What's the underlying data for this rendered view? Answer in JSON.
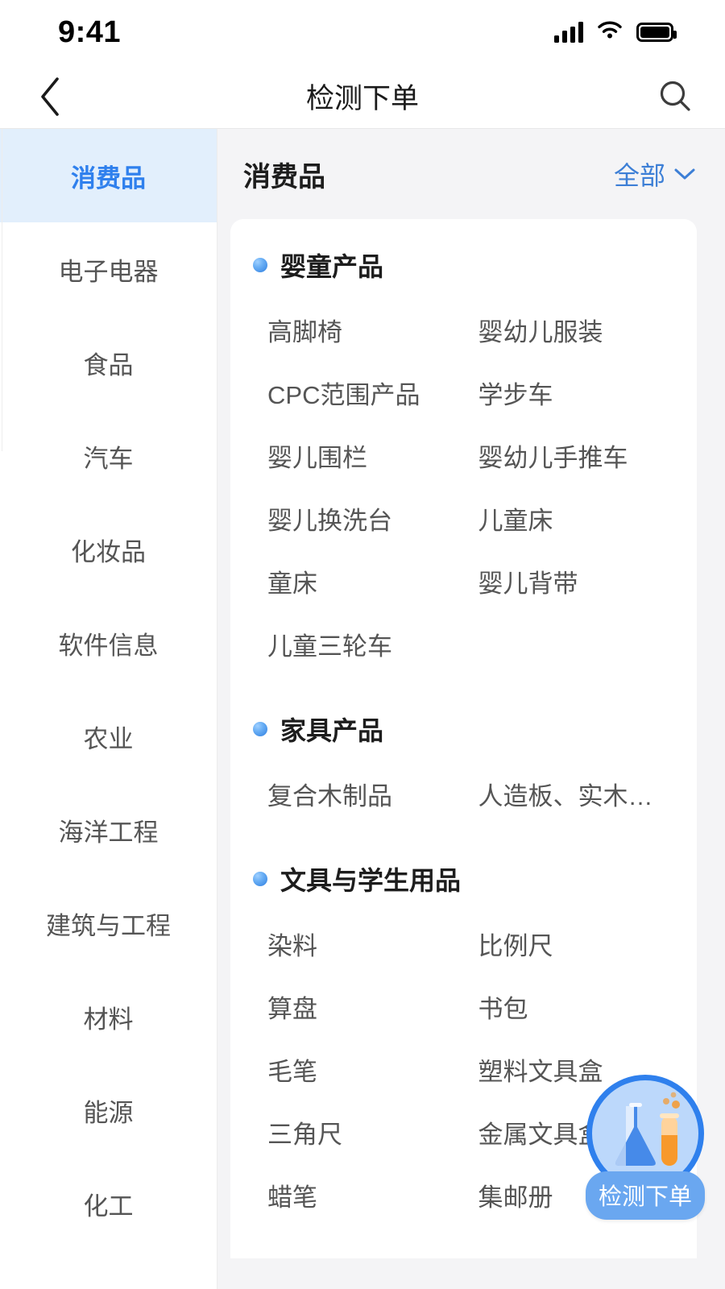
{
  "status_bar": {
    "time": "9:41",
    "icons": [
      "signal-bars-icon",
      "wifi-icon",
      "battery-icon"
    ]
  },
  "nav_bar": {
    "back_icon": "chevron-left-icon",
    "title": "检测下单",
    "search_icon": "search-icon"
  },
  "sidebar": {
    "items": [
      {
        "label": "消费品",
        "active": true
      },
      {
        "label": "电子电器",
        "active": false
      },
      {
        "label": "食品",
        "active": false
      },
      {
        "label": "汽车",
        "active": false
      },
      {
        "label": "化妆品",
        "active": false
      },
      {
        "label": "软件信息",
        "active": false
      },
      {
        "label": "农业",
        "active": false
      },
      {
        "label": "海洋工程",
        "active": false
      },
      {
        "label": "建筑与工程",
        "active": false
      },
      {
        "label": "材料",
        "active": false
      },
      {
        "label": "能源",
        "active": false
      },
      {
        "label": "化工",
        "active": false
      }
    ]
  },
  "pane": {
    "title": "消费品",
    "filter_label": "全部",
    "filter_icon": "chevron-down-icon",
    "accent_color": "#3d7fd6",
    "groups": [
      {
        "title": "婴童产品",
        "items": [
          "高脚椅",
          "婴幼儿服装",
          "CPC范围产品",
          "学步车",
          "婴儿围栏",
          "婴幼儿手推车",
          "婴儿换洗台",
          "儿童床",
          "童床",
          "婴儿背带",
          "儿童三轮车",
          ""
        ]
      },
      {
        "title": "家具产品",
        "items": [
          "复合木制品",
          "人造板、实木…"
        ]
      },
      {
        "title": "文具与学生用品",
        "items": [
          "染料",
          "比例尺",
          "算盘",
          "书包",
          "毛笔",
          "塑料文具盒",
          "三角尺",
          "金属文具盒",
          "蜡笔",
          "集邮册"
        ]
      }
    ]
  },
  "fab": {
    "label": "检测下单",
    "icon": "flask-test-tube-icon",
    "border_color": "#2f80ed",
    "fill_color": "#bcd8fb",
    "label_bg": "#6aa7f0"
  }
}
